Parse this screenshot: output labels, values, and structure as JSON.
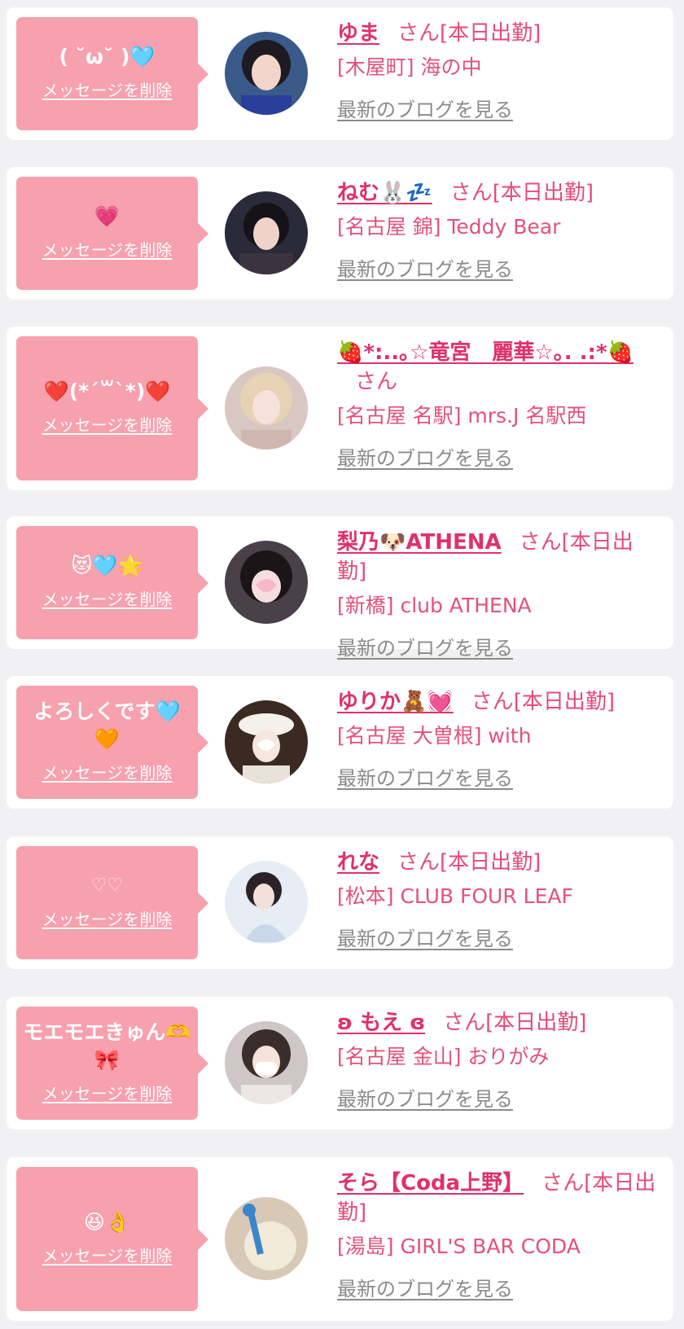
{
  "delete_label": "メッセージを削除",
  "blog_label": "最新のブログを見る",
  "san_label": "さん",
  "colors": {
    "bubble": "#f7a0ae",
    "name": "#e0306a",
    "accent": "#e4507c",
    "link_gray": "#8b8b8b"
  },
  "cards": [
    {
      "message": "( ˘ω˘ )🩵",
      "name": "ゆま",
      "status": "[本日出勤]",
      "shop": "[木屋町] 海の中"
    },
    {
      "message": "💗",
      "name": "ねむ🐰💤",
      "status": "[本日出勤]",
      "shop": "[名古屋 錦] Teddy Bear"
    },
    {
      "message": "❤️(*´꒳`*)❤️",
      "name": "🍓*:..｡☆竜宮　麗華☆｡. .:*🍓",
      "status": "",
      "shop": "[名古屋 名駅] mrs.J 名駅西"
    },
    {
      "message": "😻🩵🌟",
      "name": "梨乃🐶ATHENA",
      "status": "[本日出勤]",
      "shop": "[新橋] club ATHENA"
    },
    {
      "message": "よろしくです🩵🧡",
      "name": "ゆりか🧸💓",
      "status": "[本日出勤]",
      "shop": "[名古屋 大曽根] with"
    },
    {
      "message": "♡♡",
      "name": "れな",
      "status": "[本日出勤]",
      "shop": "[松本] CLUB FOUR LEAF"
    },
    {
      "message": "モエモエきゅん🫶🎀",
      "name": "ʚ もえ ɞ",
      "status": "[本日出勤]",
      "shop": "[名古屋 金山] おりがみ"
    },
    {
      "message": "😆👌",
      "name": "そら【Coda上野】",
      "status": "[本日出勤]",
      "shop": "[湯島] GIRL'S BAR CODA"
    }
  ]
}
